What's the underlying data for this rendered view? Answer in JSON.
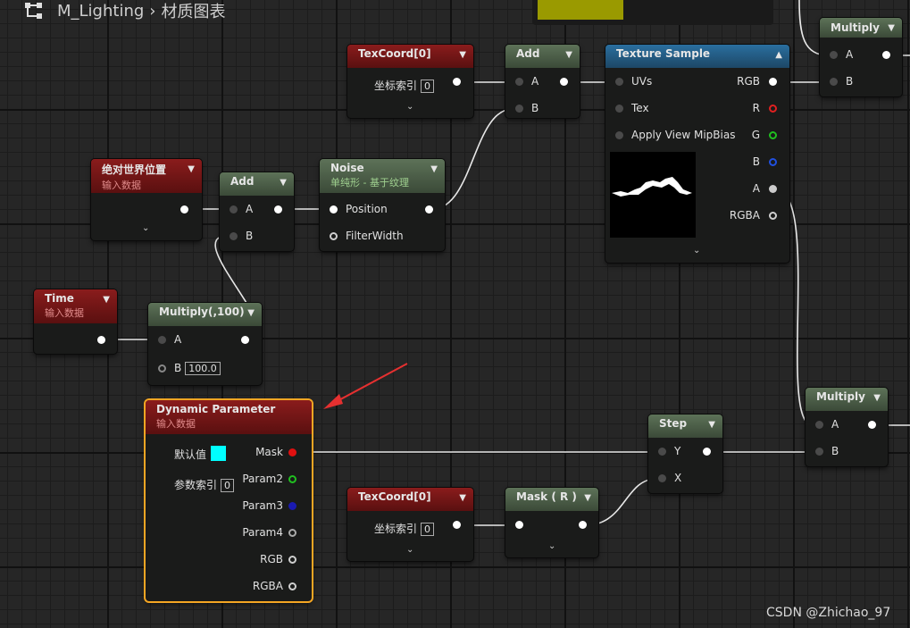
{
  "breadcrumb": {
    "asset": "M_Lighting",
    "separator": "›",
    "view": "材质图表"
  },
  "nodes": {
    "texcoord_top": {
      "title": "TexCoord[0]",
      "param_label": "坐标索引",
      "param_value": "0"
    },
    "add_top": {
      "title": "Add",
      "pin_a": "A",
      "pin_b": "B"
    },
    "texture_sample": {
      "title": "Texture Sample",
      "in_uvs": "UVs",
      "in_tex": "Tex",
      "in_mipbias": "Apply View MipBias",
      "out_rgb": "RGB",
      "out_r": "R",
      "out_g": "G",
      "out_b": "B",
      "out_a": "A",
      "out_rgba": "RGBA"
    },
    "multiply_top": {
      "title": "Multiply",
      "pin_a": "A",
      "pin_b": "B"
    },
    "absolute_world_pos": {
      "title": "绝对世界位置",
      "subtitle": "输入数据"
    },
    "add_mid": {
      "title": "Add",
      "pin_a": "A",
      "pin_b": "B"
    },
    "noise": {
      "title": "Noise",
      "subtitle": "单纯形 - 基于纹理",
      "in_position": "Position",
      "in_filterwidth": "FilterWidth"
    },
    "time": {
      "title": "Time",
      "subtitle": "输入数据"
    },
    "multiply_100": {
      "title": "Multiply(,100)",
      "pin_a": "A",
      "pin_b": "B",
      "b_value": "100.0"
    },
    "dynamic_parameter": {
      "title": "Dynamic Parameter",
      "subtitle": "输入数据",
      "default_label": "默认值",
      "index_label": "参数索引",
      "index_value": "0",
      "out_mask": "Mask",
      "out_param2": "Param2",
      "out_param3": "Param3",
      "out_param4": "Param4",
      "out_rgb": "RGB",
      "out_rgba": "RGBA"
    },
    "texcoord_bottom": {
      "title": "TexCoord[0]",
      "param_label": "坐标索引",
      "param_value": "0"
    },
    "mask_r": {
      "title": "Mask ( R )"
    },
    "step": {
      "title": "Step",
      "pin_y": "Y",
      "pin_x": "X"
    },
    "multiply_bottom": {
      "title": "Multiply",
      "pin_a": "A",
      "pin_b": "B"
    }
  },
  "watermark": "CSDN @Zhichao_97",
  "colors": {
    "accent_selected": "#f5a623",
    "annotation_arrow": "#e53030",
    "default_color_swatch": "#00ffff",
    "preview_yellow": "#9a9a00"
  }
}
